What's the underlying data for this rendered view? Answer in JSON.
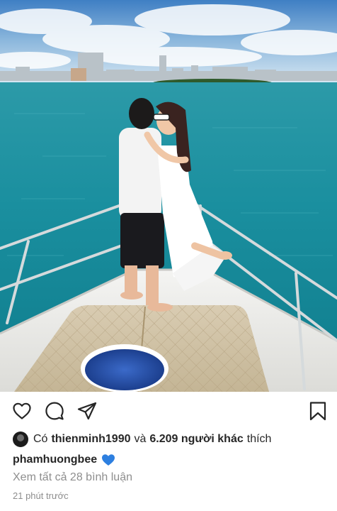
{
  "post": {
    "photo_description": "post-photo",
    "likes": {
      "prefix": "Có",
      "first_user": "thienminh1990",
      "connector": "và",
      "others": "6.209 người khác",
      "suffix": "thích"
    },
    "caption": {
      "username": "phamhuongbee",
      "emoji": "blue-heart"
    },
    "view_comments": "Xem tất cả 28 bình luận",
    "timestamp": "21 phút trước"
  },
  "icons": {
    "like": "heart-outline-icon",
    "comment": "comment-bubble-icon",
    "share": "paper-plane-icon",
    "save": "bookmark-icon"
  },
  "colors": {
    "text": "#262626",
    "secondary": "#8e8e8e",
    "emoji_blue": "#2d7fe0"
  }
}
